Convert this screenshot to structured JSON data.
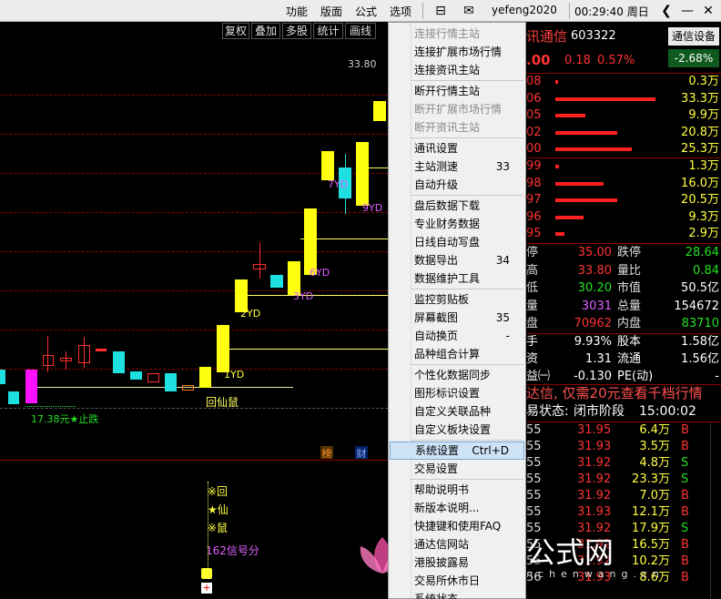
{
  "topbar": {
    "menus": [
      "功能",
      "版面",
      "公式",
      "选项"
    ],
    "user": "yefeng2020",
    "clock": "00:29:40 周日",
    "icons": [
      "mail-icon",
      "dropdown-icon",
      "back-icon",
      "minimize-icon",
      "close-icon"
    ]
  },
  "chart_toolbar": [
    "复权",
    "叠加",
    "多股",
    "统计",
    "画线"
  ],
  "chart": {
    "price_label": "33.80",
    "limit_label": "17.38元★止跌",
    "pattern_label": "回仙鼠",
    "yd_labels": [
      "1YD",
      "2YD",
      "3YD",
      "6YD",
      "7YD",
      "9YD"
    ],
    "tags": [
      "榜",
      "财"
    ],
    "signals": [
      "※回",
      "★仙",
      "※鼠"
    ],
    "signal_count": "162信号分"
  },
  "context_menu": {
    "groups": [
      [
        {
          "label": "连接行情主站",
          "disabled": true
        },
        {
          "label": "连接扩展市场行情",
          "disabled": false
        },
        {
          "label": "连接资讯主站",
          "disabled": false
        }
      ],
      [
        {
          "label": "断开行情主站",
          "disabled": false
        },
        {
          "label": "断开扩展市场行情",
          "disabled": true
        },
        {
          "label": "断开资讯主站",
          "disabled": true
        }
      ],
      [
        {
          "label": "通讯设置",
          "disabled": false
        },
        {
          "label": "主站测速",
          "shortcut": "33",
          "disabled": false
        },
        {
          "label": "自动升级",
          "disabled": false
        }
      ],
      [
        {
          "label": "盘后数据下载",
          "disabled": false
        },
        {
          "label": "专业财务数据",
          "disabled": false
        },
        {
          "label": "日线自动写盘",
          "disabled": false
        },
        {
          "label": "数据导出",
          "shortcut": "34",
          "disabled": false
        },
        {
          "label": "数据维护工具",
          "disabled": false
        }
      ],
      [
        {
          "label": "监控剪贴板",
          "disabled": false
        },
        {
          "label": "屏幕截图",
          "shortcut": "35",
          "disabled": false
        },
        {
          "label": "自动换页",
          "shortcut": "-",
          "disabled": false
        },
        {
          "label": "品种组合计算",
          "disabled": false
        }
      ],
      [
        {
          "label": "个性化数据同步",
          "disabled": false
        },
        {
          "label": "图形标识设置",
          "disabled": false
        },
        {
          "label": "自定义关联品种",
          "disabled": false
        },
        {
          "label": "自定义板块设置",
          "disabled": false
        }
      ],
      [
        {
          "label": "系统设置",
          "shortcut": "Ctrl+D",
          "disabled": false,
          "selected": true
        },
        {
          "label": "交易设置",
          "disabled": false
        }
      ],
      [
        {
          "label": "帮助说明书",
          "disabled": false
        },
        {
          "label": "新版本说明...",
          "disabled": false
        },
        {
          "label": "快捷键和使用FAQ",
          "disabled": false
        },
        {
          "label": "通达信网站",
          "disabled": false
        },
        {
          "label": "港股披露易",
          "disabled": false
        },
        {
          "label": "交易所休市日",
          "disabled": false
        },
        {
          "label": "系统状态",
          "disabled": false
        }
      ]
    ]
  },
  "stock": {
    "name": "讯通信",
    "code": "603322",
    "sector": "通信设备",
    "sector_change": "-2.68%",
    "price_tail": ".00",
    "change": "0.18",
    "change_pct": "0.57%"
  },
  "order_book": {
    "sell": [
      {
        "price": "08",
        "vol": "0.3万",
        "fill": 0.02
      },
      {
        "price": "06",
        "vol": "33.3万",
        "fill": 1.0
      },
      {
        "price": "05",
        "vol": "9.9万",
        "fill": 0.3
      },
      {
        "price": "02",
        "vol": "20.8万",
        "fill": 0.62
      },
      {
        "price": "00",
        "vol": "25.3万",
        "fill": 0.76
      }
    ],
    "buy": [
      {
        "price": "99",
        "vol": "1.3万",
        "fill": 0.04
      },
      {
        "price": "98",
        "vol": "16.0万",
        "fill": 0.48
      },
      {
        "price": "97",
        "vol": "20.5万",
        "fill": 0.62
      },
      {
        "price": "96",
        "vol": "9.3万",
        "fill": 0.28
      },
      {
        "price": "95",
        "vol": "2.9万",
        "fill": 0.09
      }
    ]
  },
  "stats": [
    {
      "k1": "停",
      "v1": "35.00",
      "c1": "red",
      "k2": "跌停",
      "v2": "28.64",
      "c2": "green"
    },
    {
      "k1": "高",
      "v1": "33.80",
      "c1": "red",
      "k2": "量比",
      "v2": "0.84",
      "c2": "green"
    },
    {
      "k1": "低",
      "v1": "30.20",
      "c1": "green",
      "k2": "市值",
      "v2": "50.5亿",
      "c2": "wht"
    },
    {
      "k1": "量",
      "v1": "3031",
      "c1": "mag",
      "k2": "总量",
      "v2": "154672",
      "c2": "wht"
    },
    {
      "k1": "盘",
      "v1": "70962",
      "c1": "red",
      "k2": "内盘",
      "v2": "83710",
      "c2": "green"
    }
  ],
  "finance": [
    {
      "k1": "手",
      "v1": "9.93%",
      "k2": "股本",
      "v2": "1.58亿"
    },
    {
      "k1": "资",
      "v1": "1.31",
      "k2": "流通",
      "v2": "1.56亿"
    },
    {
      "k1": "益㈠",
      "v1": "-0.130",
      "k2": "PE(动)",
      "v2": "-"
    }
  ],
  "promo": "达信, 仅需20元查看千档行情",
  "trade_status": {
    "label": "易状态:",
    "state": "闭市阶段",
    "time": "15:00:02"
  },
  "ticks": [
    {
      "t": "55",
      "p": "31.95",
      "v": "6.4万",
      "s": "B"
    },
    {
      "t": "55",
      "p": "31.93",
      "v": "3.5万",
      "s": "B"
    },
    {
      "t": "55",
      "p": "31.92",
      "v": "4.8万",
      "s": "S"
    },
    {
      "t": "55",
      "p": "31.92",
      "v": "23.3万",
      "s": "S"
    },
    {
      "t": "55",
      "p": "31.92",
      "v": "7.0万",
      "s": "B"
    },
    {
      "t": "55",
      "p": "31.93",
      "v": "12.1万",
      "s": "B"
    },
    {
      "t": "55",
      "p": "31.92",
      "v": "17.9万",
      "s": "S"
    },
    {
      "t": "55",
      "p": "31.92",
      "v": "16.5万",
      "s": "B"
    },
    {
      "t": "55",
      "p": "31.92",
      "v": "10.2万",
      "s": "B"
    },
    {
      "t": "56",
      "p": "31.93",
      "v": "8.6万",
      "s": "B"
    }
  ],
  "watermark": {
    "cn": "梵宸指标公式网",
    "en": "www.fanchenwang.cn"
  }
}
